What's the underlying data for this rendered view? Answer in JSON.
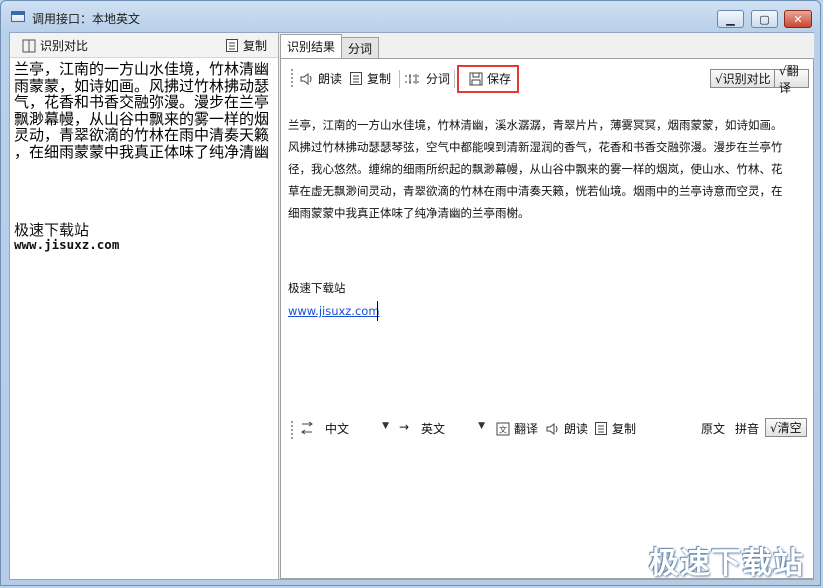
{
  "window": {
    "title": "调用接口：本地英文",
    "min": "▁",
    "max": "▢",
    "close": "✕"
  },
  "left": {
    "toolbar": {
      "compare": "识别对比",
      "copy": "复制"
    },
    "text_lines": [
      "兰亭，江南的一方山水佳境，竹林清幽",
      "雨蒙蒙，如诗如画。风拂过竹林拂动瑟",
      "气，花香和书香交融弥漫。漫步在兰亭",
      "飘渺幕幔，从山谷中飘来的雾一样的烟",
      "灵动，青翠欲滴的竹林在雨中清奏天籁",
      "，在细雨蒙蒙中我真正体味了纯净清幽"
    ],
    "extra_title": "极速下载站",
    "extra_url": "www.jisuxz.com"
  },
  "tabs": [
    "识别结果",
    "分词"
  ],
  "toolbar": {
    "read": "朗读",
    "copy": "复制",
    "segment": "分词",
    "save": "保存",
    "compare": "√识别对比",
    "translate": "√翻译"
  },
  "result": {
    "lines": [
      "兰亭，江南的一方山水佳境，竹林清幽，溪水潺潺，青翠片片，薄雾冥冥，烟雨蒙蒙，如诗如画。",
      "风拂过竹林拂动瑟瑟琴弦，空气中都能嗅到清新湿润的香气，花香和书香交融弥漫。漫步在兰亭竹",
      "径，我心悠然。缠绵的细雨所织起的飘渺幕幔，从山谷中飘来的雾一样的烟岚，使山水、竹林、花",
      "草在虚无飘渺间灵动，青翠欲滴的竹林在雨中清奏天籁，恍若仙境。烟雨中的兰亭诗意而空灵，在",
      "细雨蒙蒙中我真正体味了纯净清幽的兰亭雨榭。"
    ],
    "extra_title": "极速下载站",
    "extra_url": "www.jisuxz.com"
  },
  "translate_bar": {
    "source_lang": "中文",
    "arrow": "→",
    "target_lang": "英文",
    "translate": "翻译",
    "read": "朗读",
    "copy": "复制",
    "original": "原文",
    "pinyin": "拼音",
    "clear": "√清空"
  },
  "watermark": "极速下载站",
  "colors": {
    "highlight": "#e53935",
    "link": "#1a4fd6"
  }
}
